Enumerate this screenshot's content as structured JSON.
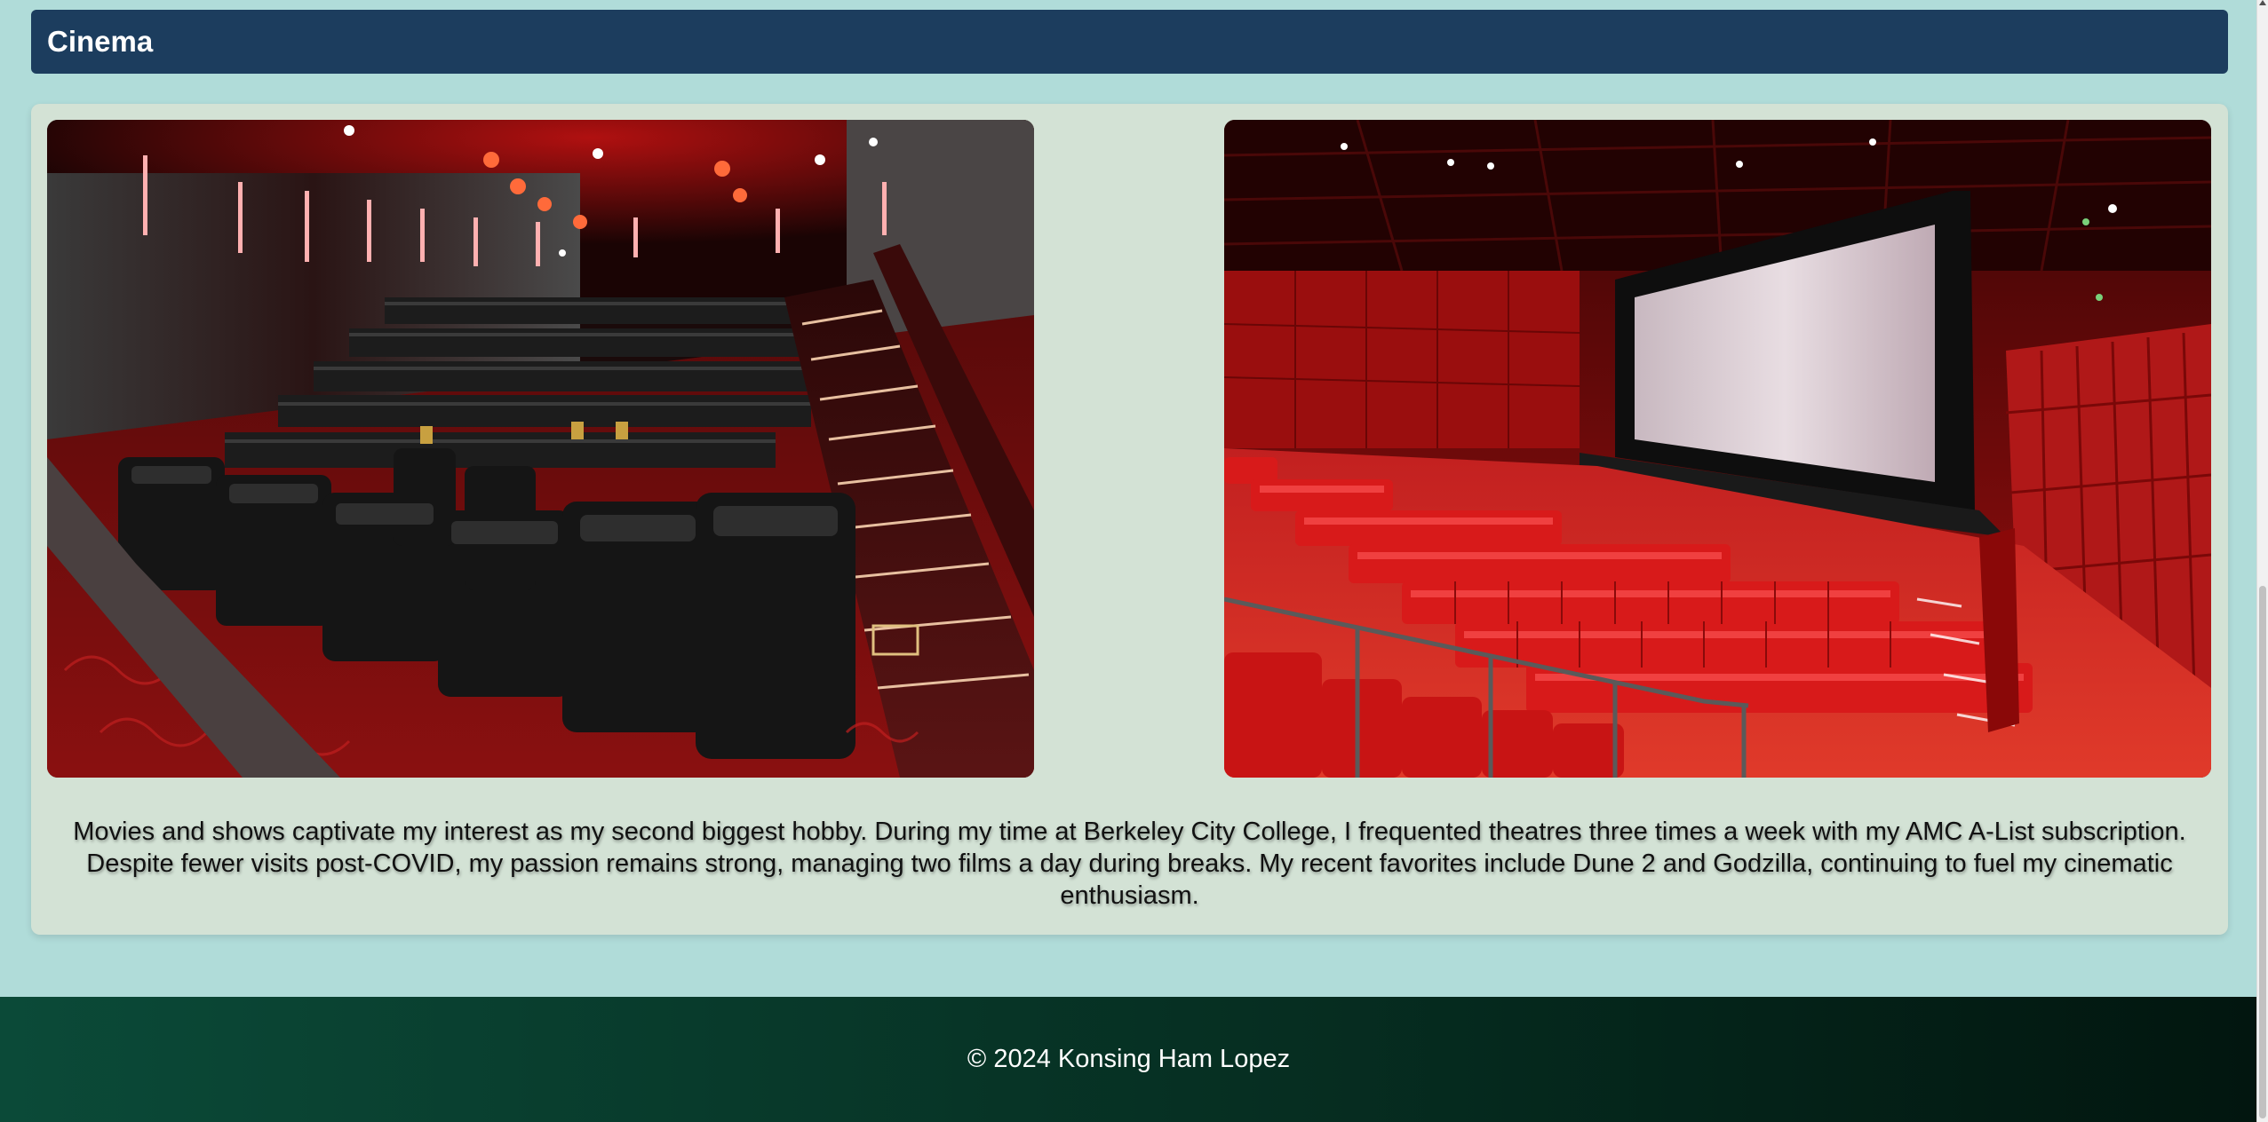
{
  "section": {
    "title": "Cinema"
  },
  "photos": [
    {
      "subject": "theater with black leather recliners and red-lit stairs"
    },
    {
      "subject": "red-seat auditorium facing a large screen"
    }
  ],
  "description": "Movies and shows captivate my interest as my second biggest hobby. During my time at Berkeley City College, I frequented theatres three times a week with my AMC A-List subscription. Despite fewer visits post-COVID, my passion remains strong, managing two films a day during breaks. My recent favorites include Dune 2 and Godzilla, continuing to fuel my cinematic enthusiasm.",
  "footer": {
    "copyright": "© 2024 Konsing Ham Lopez"
  },
  "colors": {
    "background": "#b0dcd9",
    "header": "#1c3d5e",
    "card": "#d3e2d5",
    "footer_start": "#0b4a38",
    "footer_end": "#02160f"
  }
}
